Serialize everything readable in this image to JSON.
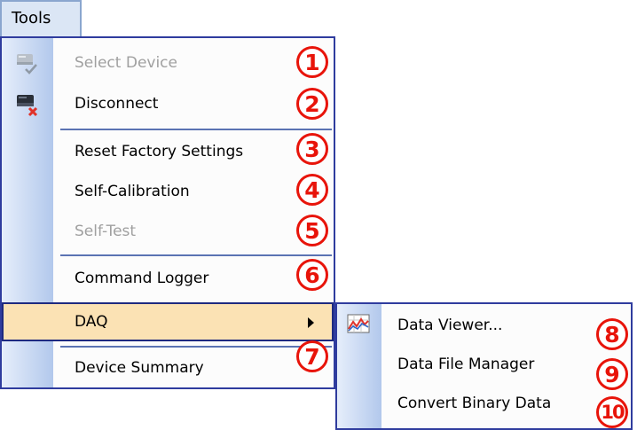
{
  "menubar": {
    "tools_label": "Tools"
  },
  "menu": {
    "items": [
      {
        "label": "Select Device",
        "disabled": true,
        "badge": "1",
        "icon": "device-check-icon"
      },
      {
        "label": "Disconnect",
        "disabled": false,
        "badge": "2",
        "icon": "device-disconnect-icon"
      },
      {
        "label": "Reset Factory Settings",
        "disabled": false,
        "badge": "3"
      },
      {
        "label": "Self-Calibration",
        "disabled": false,
        "badge": "4"
      },
      {
        "label": "Self-Test",
        "disabled": true,
        "badge": "5"
      },
      {
        "label": "Command Logger",
        "disabled": false,
        "badge": "6"
      },
      {
        "label": "DAQ",
        "disabled": false,
        "highlighted": true,
        "has_submenu": true
      },
      {
        "label": "Device Summary",
        "disabled": false,
        "badge": "7"
      }
    ]
  },
  "submenu": {
    "items": [
      {
        "label": "Data Viewer...",
        "badge": "8",
        "icon": "chart-icon"
      },
      {
        "label": "Data File Manager",
        "badge": "9"
      },
      {
        "label": "Convert Binary Data",
        "badge": "10"
      }
    ]
  },
  "colors": {
    "badge": "#e8140a",
    "highlight": "#fbe2b4",
    "border": "#2f3c9e",
    "disabled_text": "#a0a0a0"
  }
}
